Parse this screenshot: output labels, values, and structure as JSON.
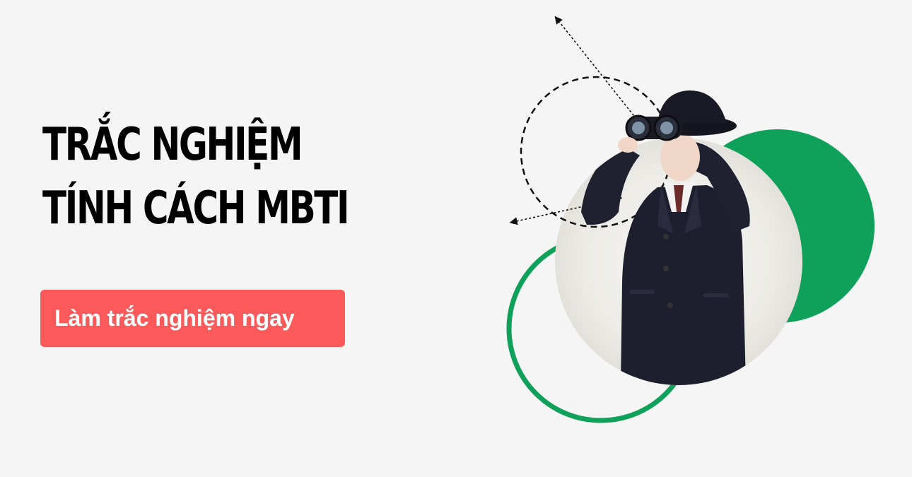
{
  "headline": {
    "line1": "TRẮC NGHIỆM",
    "line2": "TÍNH CÁCH MBTI"
  },
  "cta": {
    "label": "Làm trắc nghiệm ngay"
  },
  "colors": {
    "background": "#f5f5f5",
    "accent_green": "#0fa05a",
    "button_red": "#fc5a5a",
    "text": "#000000"
  },
  "illustration": {
    "icon": "person-with-binoculars-icon"
  }
}
